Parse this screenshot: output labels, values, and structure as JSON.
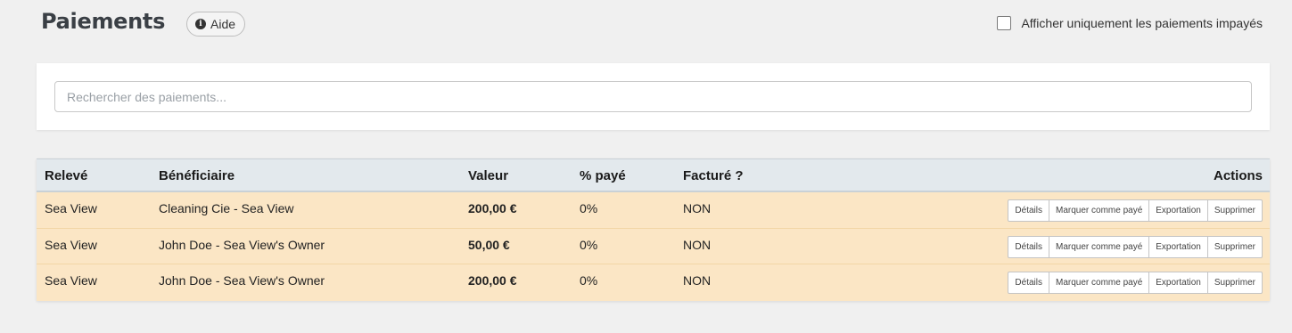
{
  "page": {
    "title": "Paiements",
    "help_label": "Aide",
    "help_icon": "info-icon",
    "filter_label": "Afficher uniquement les paiements impayés",
    "filter_checked": false
  },
  "search": {
    "placeholder": "Rechercher des paiements...",
    "value": ""
  },
  "table": {
    "headers": {
      "statement": "Relevé",
      "beneficiary": "Bénéficiaire",
      "value": "Valeur",
      "paid_pct": "% payé",
      "invoiced": "Facturé ?",
      "actions": "Actions"
    },
    "actions": [
      "Détails",
      "Marquer comme payé",
      "Exportation",
      "Supprimer"
    ],
    "rows": [
      {
        "statement": "Sea View",
        "beneficiary": "Cleaning Cie - Sea View",
        "value": "200,00 €",
        "paid_pct": "0%",
        "invoiced": "NON"
      },
      {
        "statement": "Sea View",
        "beneficiary": "John Doe - Sea View's Owner",
        "value": "50,00 €",
        "paid_pct": "0%",
        "invoiced": "NON"
      },
      {
        "statement": "Sea View",
        "beneficiary": "John Doe - Sea View's Owner",
        "value": "200,00 €",
        "paid_pct": "0%",
        "invoiced": "NON"
      }
    ]
  },
  "colors": {
    "row_background": "#fbe6c5",
    "header_background": "#e3e9ed",
    "page_background": "#f0f0f0"
  }
}
